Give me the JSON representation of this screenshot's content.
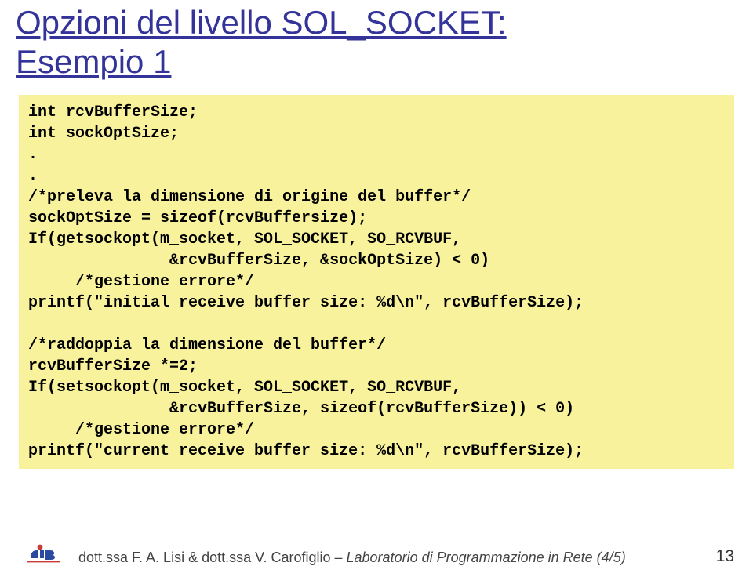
{
  "title_line1": "Opzioni del livello SOL_SOCKET:",
  "title_line2": "Esempio 1",
  "code": "int rcvBufferSize;\nint sockOptSize;\n.\n.\n/*preleva la dimensione di origine del buffer*/\nsockOptSize = sizeof(rcvBuffersize);\nIf(getsockopt(m_socket, SOL_SOCKET, SO_RCVBUF,\n               &rcvBufferSize, &sockOptSize) < 0)\n     /*gestione errore*/\nprintf(\"initial receive buffer size: %d\\n\", rcvBufferSize);\n\n/*raddoppia la dimensione del buffer*/\nrcvBufferSize *=2;\nIf(setsockopt(m_socket, SOL_SOCKET, SO_RCVBUF,\n               &rcvBufferSize, sizeof(rcvBufferSize)) < 0)\n     /*gestione errore*/\nprintf(\"current receive buffer size: %d\\n\", rcvBufferSize);",
  "footer_authors": "dott.ssa F. A. Lisi & dott.ssa V. Carofiglio – ",
  "footer_course": "Laboratorio di Programmazione in Rete (4/5)",
  "page_number": "13"
}
